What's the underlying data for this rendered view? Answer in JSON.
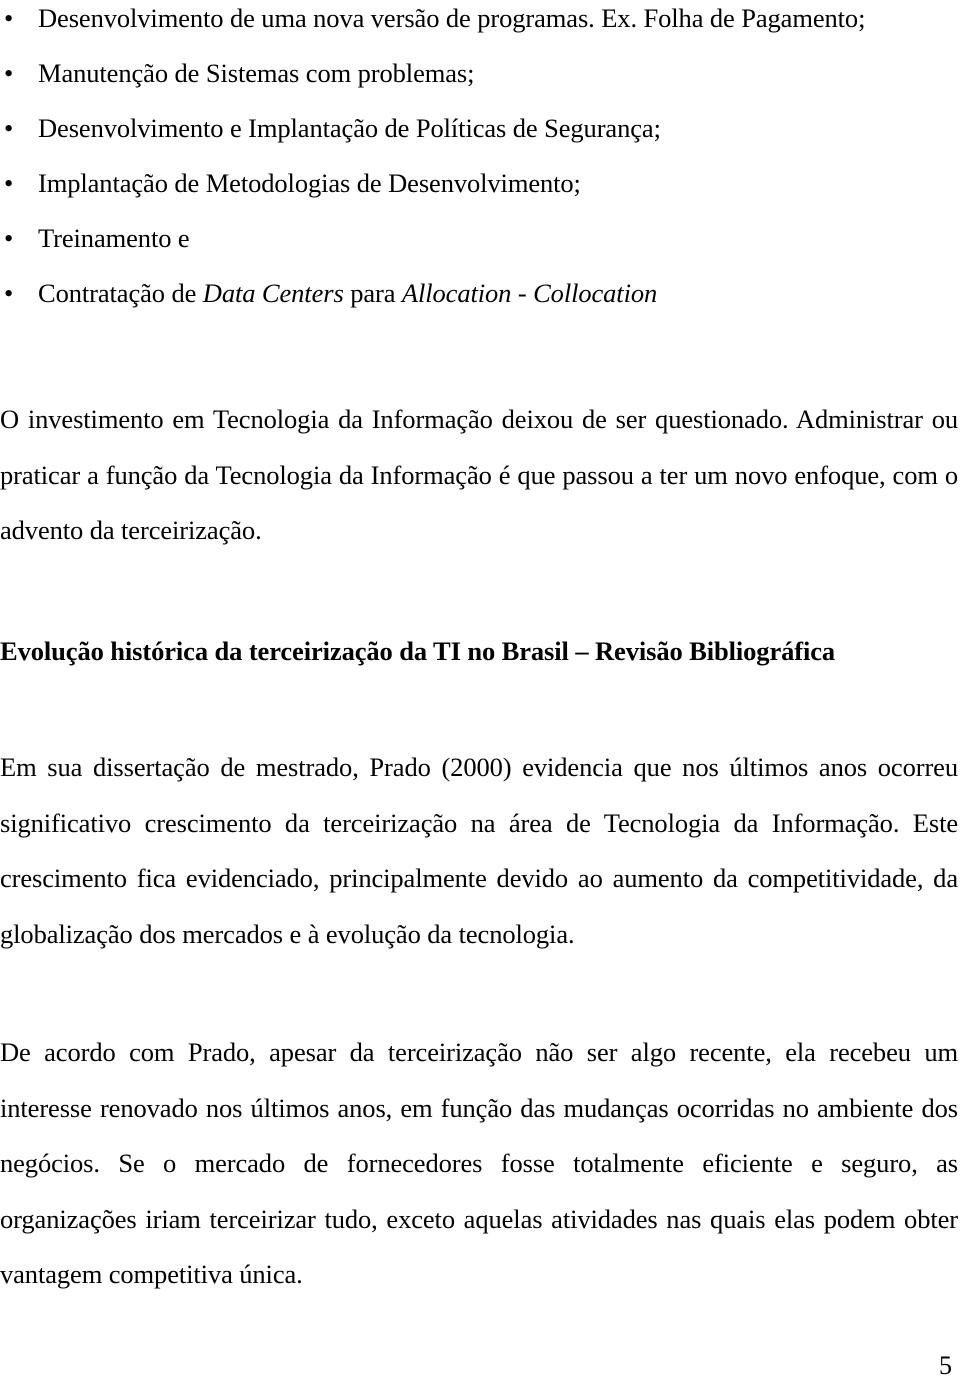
{
  "document": {
    "page_number": "5",
    "bullets": [
      {
        "marker": "•",
        "text": "Desenvolvimento de uma nova versão de programas. Ex. Folha de Pagamento;"
      },
      {
        "marker": "•",
        "text": "Manutenção de Sistemas com problemas;"
      },
      {
        "marker": "•",
        "text": "Desenvolvimento e Implantação de Políticas de Segurança;"
      },
      {
        "marker": "•",
        "text": "Implantação de Metodologias de Desenvolvimento;"
      },
      {
        "marker": "•",
        "text": "Treinamento e"
      },
      {
        "marker": "•",
        "segments": [
          {
            "text": "Contratação de ",
            "style": "normal"
          },
          {
            "text": "Data Centers",
            "style": "italic"
          },
          {
            "text": " para ",
            "style": "normal"
          },
          {
            "text": "Allocation - Collocation",
            "style": "italic"
          }
        ],
        "text": "Contratação de Data Centers para Allocation - Collocation"
      }
    ],
    "paragraph_1": "O investimento em Tecnologia da Informação deixou de ser questionado. Administrar ou praticar a função da Tecnologia da Informação é que passou a ter um novo enfoque, com o advento da terceirização.",
    "heading": "Evolução histórica da terceirização da TI no Brasil – Revisão Bibliográfica",
    "paragraph_2": "Em sua dissertação de mestrado, Prado (2000) evidencia que nos últimos anos ocorreu significativo crescimento da terceirização na área de Tecnologia da Informação. Este crescimento fica evidenciado, principalmente devido ao aumento da competitividade, da globalização dos mercados e à evolução da tecnologia.",
    "paragraph_3": "De acordo com Prado, apesar da terceirização não ser algo recente, ela recebeu um interesse renovado nos últimos anos, em função das mudanças ocorridas no ambiente dos negócios. Se o mercado de fornecedores fosse totalmente eficiente e seguro, as organizações iriam terceirizar tudo, exceto aquelas atividades nas quais elas podem obter vantagem competitiva única."
  }
}
